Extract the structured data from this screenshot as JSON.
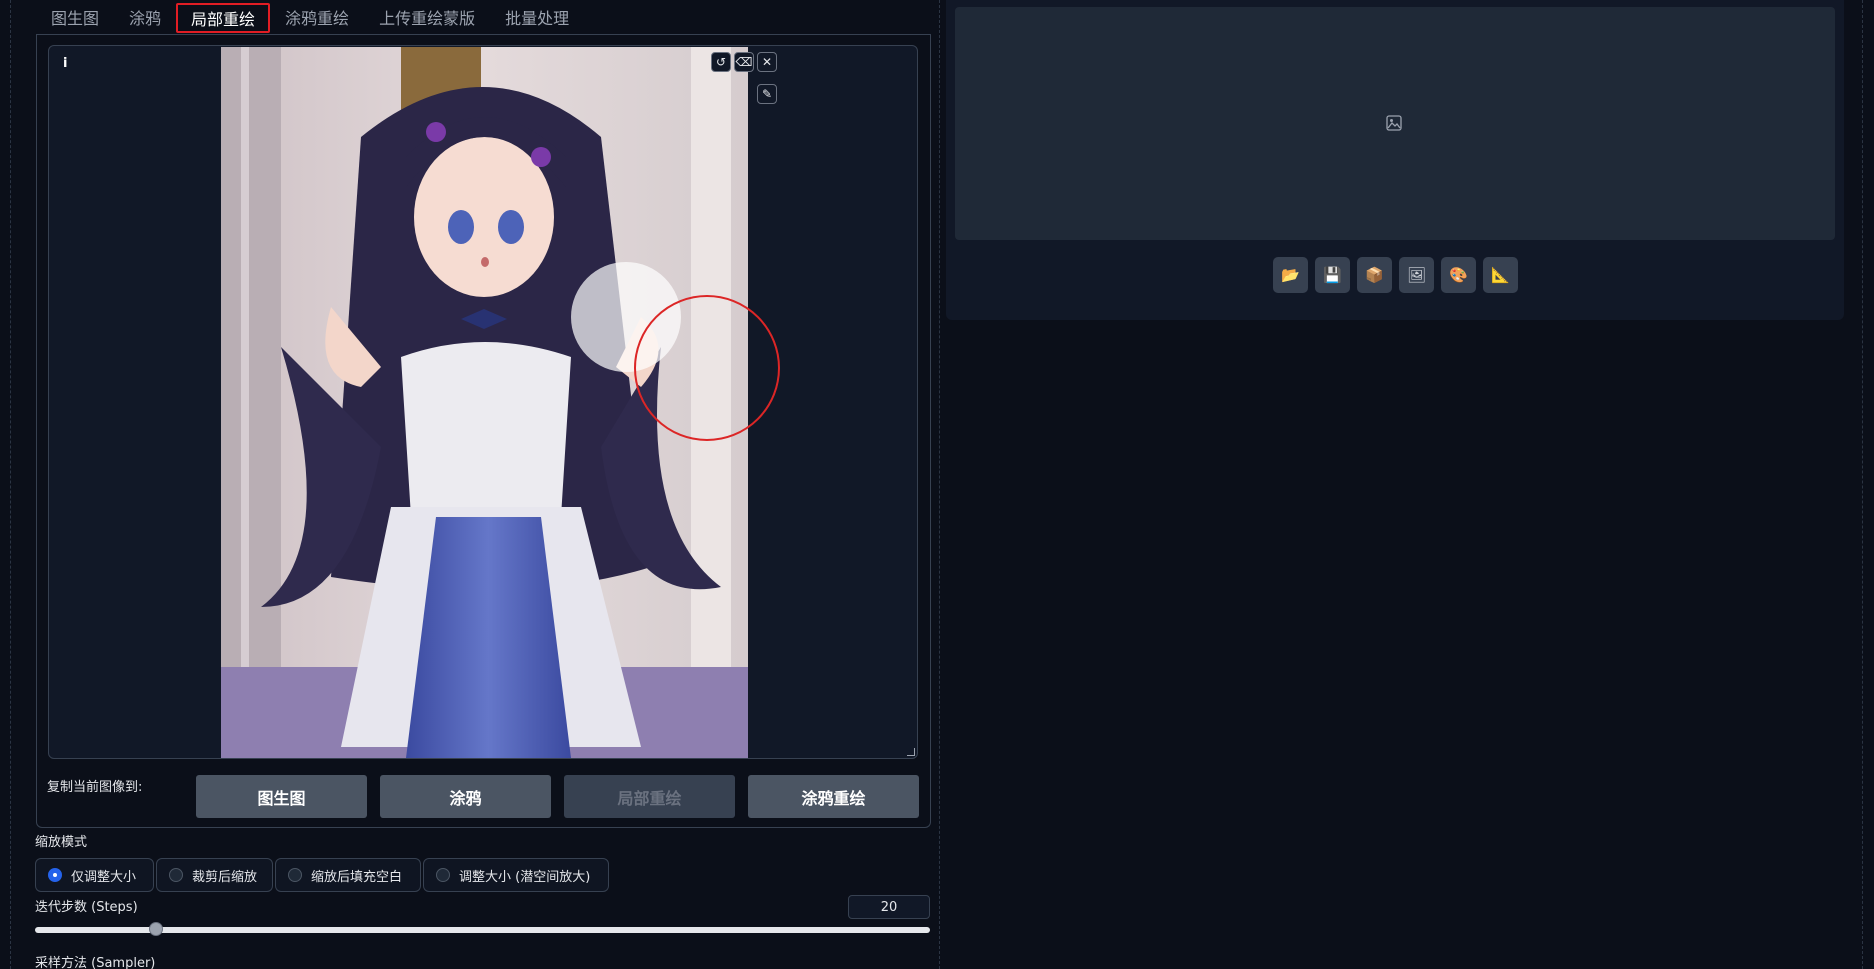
{
  "tabs": [
    {
      "label": "图生图"
    },
    {
      "label": "涂鸦"
    },
    {
      "label": "局部重绘"
    },
    {
      "label": "涂鸦重绘"
    },
    {
      "label": "上传重绘蒙版"
    },
    {
      "label": "批量处理"
    }
  ],
  "active_tab": "局部重绘",
  "canvas": {
    "info_icon": "i",
    "icons": [
      "undo-icon",
      "eraser-icon",
      "close-icon",
      "brush-icon"
    ]
  },
  "copy": {
    "label": "复制当前图像到:",
    "buttons": [
      "图生图",
      "涂鸦",
      "局部重绘",
      "涂鸦重绘"
    ],
    "disabled": "局部重绘"
  },
  "resize_mode": {
    "label": "缩放模式",
    "options": [
      "仅调整大小",
      "裁剪后缩放",
      "缩放后填充空白",
      "调整大小 (潜空间放大)"
    ],
    "selected": "仅调整大小"
  },
  "steps": {
    "label": "迭代步数 (Steps)",
    "value": "20",
    "fraction": 0.135
  },
  "sampler": {
    "label": "采样方法 (Sampler)"
  },
  "output": {
    "toolbar": [
      "folder-icon",
      "save-icon",
      "zip-icon",
      "image-send-icon",
      "palette-icon",
      "ruler-icon"
    ]
  },
  "colors": {
    "accent": "#2563eb",
    "active_tab_border": "#e11d24",
    "mask_circle": "#dc2626"
  }
}
